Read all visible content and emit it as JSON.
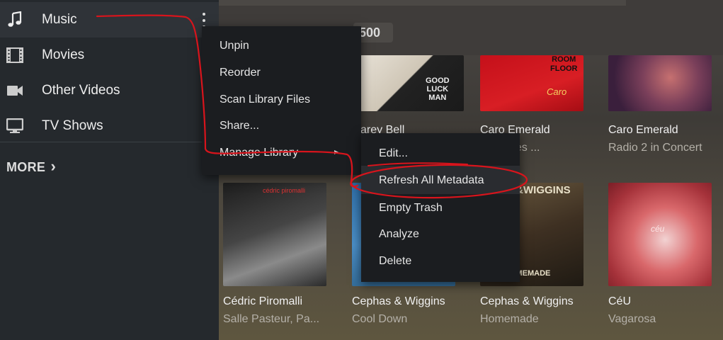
{
  "sidebar": {
    "items": [
      {
        "label": "Music",
        "icon": "music-note-icon",
        "active": true
      },
      {
        "label": "Movies",
        "icon": "film-icon"
      },
      {
        "label": "Other Videos",
        "icon": "video-camera-icon"
      },
      {
        "label": "TV Shows",
        "icon": "monitor-icon"
      }
    ],
    "more_label": "MORE",
    "more_chevron": "›"
  },
  "header": {
    "count": "500"
  },
  "context_menu": {
    "items": [
      "Unpin",
      "Reorder",
      "Scan Library Files",
      "Share...",
      "Manage Library"
    ],
    "submenu_arrow": "▸"
  },
  "submenu": {
    "items": [
      "Edit...",
      "Refresh All Metadata",
      "Empty Trash",
      "Analyze",
      "Delete"
    ],
    "highlighted": "Refresh All Metadata"
  },
  "albums_row1": [
    {
      "title": "arey Bell",
      "subtitle": "",
      "cover_text": [
        "GOOD",
        "LUCK",
        "MAN"
      ]
    },
    {
      "title": "Caro Emerald",
      "subtitle": "d Scenes ...",
      "cover_text": [
        "ROOM",
        "FLOOR",
        "Caro"
      ]
    },
    {
      "title": "Caro Emerald",
      "subtitle": "Radio 2 in Concert",
      "cover_text": []
    }
  ],
  "albums_row2": [
    {
      "title": "Cédric Piromalli",
      "subtitle": "Salle Pasteur, Pa...",
      "cover_text": [
        "cédric piromalli"
      ]
    },
    {
      "title": "Cephas & Wiggins",
      "subtitle": "Cool Down",
      "cover_text": []
    },
    {
      "title": "Cephas & Wiggins",
      "subtitle": "Homemade",
      "cover_text": [
        "S &WIGGINS",
        "HOMEMADE"
      ]
    },
    {
      "title": "CéU",
      "subtitle": "Vagarosa",
      "cover_text": [
        "céu"
      ]
    }
  ],
  "annotation_color": "#d8141c"
}
